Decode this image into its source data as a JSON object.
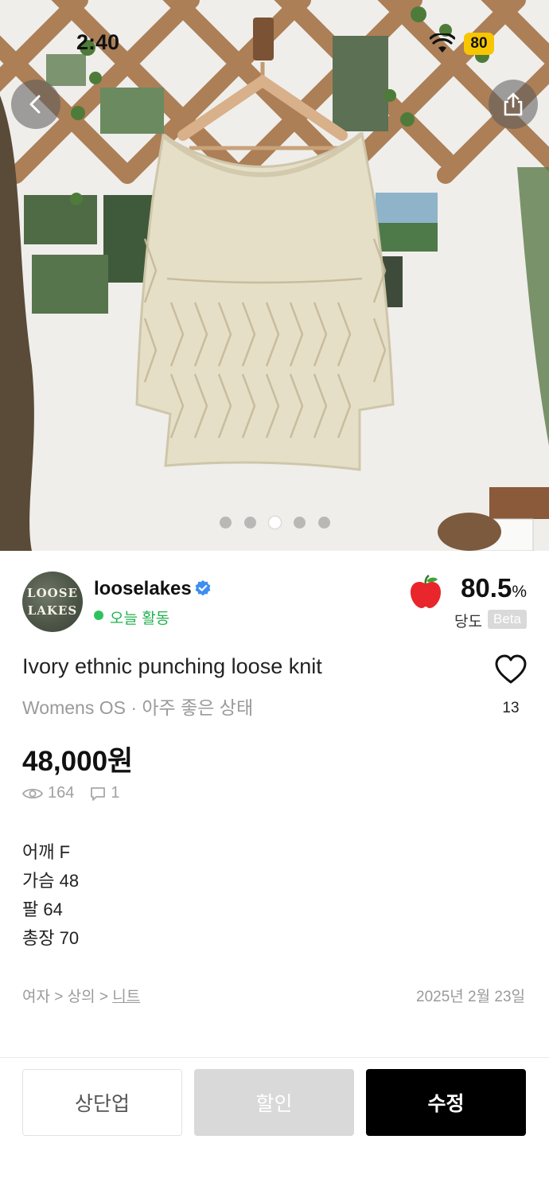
{
  "status_bar": {
    "time": "2:40",
    "battery": "80"
  },
  "gallery": {
    "image_count": 5,
    "active_index": 2
  },
  "seller": {
    "avatar_text": [
      "LOOSE",
      "LAKES"
    ],
    "name": "looselakes",
    "activity": "오늘 활동",
    "score_value": "80.5",
    "score_unit": "%",
    "score_label": "당도",
    "score_badge": "Beta"
  },
  "product": {
    "title": "Ivory ethnic punching loose knit",
    "subtitle": "Womens OS · 아주 좋은 상태",
    "likes": "13",
    "price": "48,000원",
    "views": "164",
    "comments": "1",
    "description": [
      "어깨 F",
      "가슴 48",
      "팔 64",
      "총장 70"
    ],
    "breadcrumb": {
      "part1": "여자 > 상의 > ",
      "link": "니트"
    },
    "date": "2025년 2월 23일"
  },
  "actions": {
    "bump": "상단업",
    "discount": "할인",
    "edit": "수정"
  },
  "colors": {
    "accent_green": "#2ec25f",
    "verified_blue": "#3d8ef0",
    "primary_button": "#000000"
  }
}
